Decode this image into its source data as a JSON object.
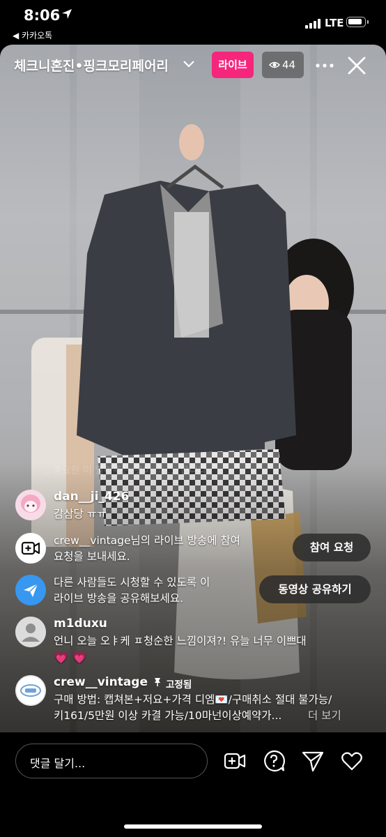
{
  "status_bar": {
    "time": "8:06",
    "back_app": "◀ 카카오톡",
    "network": "LTE"
  },
  "header": {
    "title": "체크니혼진•핑크모리페어리",
    "live_label": "라이브",
    "viewer_count": "44"
  },
  "overlay_faded_text": "…중요한 이 알아주는 옷이 좋 … 합니다",
  "comments": [
    {
      "username": "dan__ji_426",
      "text": "감삼당 ㅠㅠ"
    },
    {
      "line1": "crew__vintage님의 라이브 방송에 참여",
      "line2": "요청을 보내세요.",
      "button": "참여 요청"
    },
    {
      "line1": "다른 사람들도 시청할 수 있도록 이",
      "line2": "라이브 방송을 공유해보세요.",
      "button": "동영상 공유하기"
    },
    {
      "username": "m1duxu",
      "text": "언니 오늘 오ㅑ케 ㅍ청순한 느낌이져?! 유늘 너무 이쁘대",
      "emoji": "💗 💗"
    },
    {
      "username": "crew__vintage",
      "pinned": "고정됨",
      "line1": "구매 방법: 캡쳐본+저요+가격 디엠💌/구매취소 절대 불가능/",
      "line2": "키161/5만원 이상 카결 가능/10마넌이상예약가...",
      "more": "더 보기"
    }
  ],
  "bottom_bar": {
    "comment_placeholder": "댓글 달기..."
  },
  "colors": {
    "live": "#f5267c",
    "share_icon": "#3897f0"
  }
}
